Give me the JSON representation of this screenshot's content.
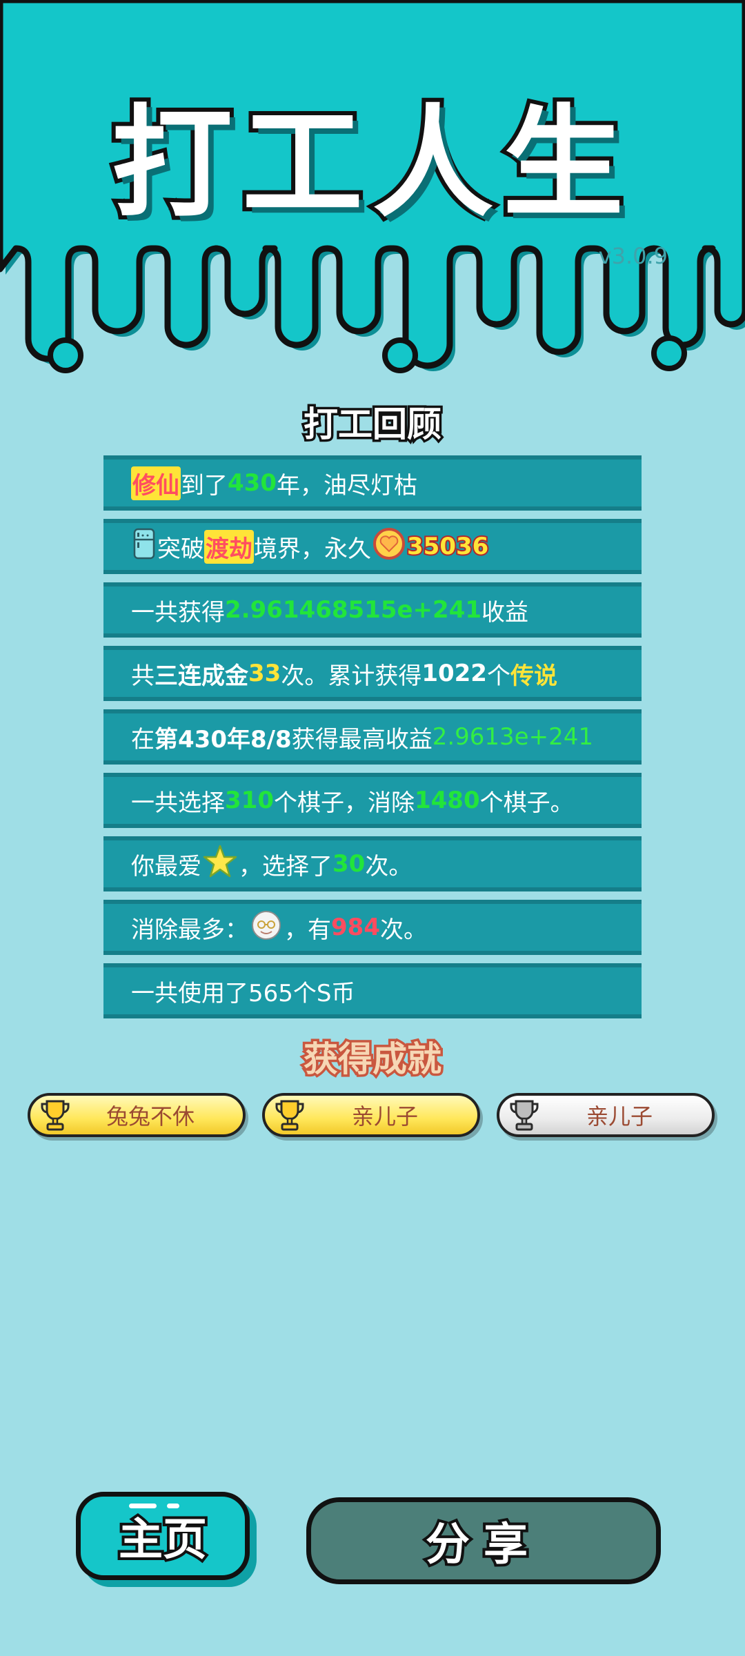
{
  "header": {
    "title": "打工人生",
    "version": "v3.0.9",
    "colors": {
      "teal": "#14c6c9",
      "outline": "#111111",
      "background": "#9fdee6"
    }
  },
  "review": {
    "title": "打工回顾",
    "rows": [
      {
        "parts": [
          {
            "text": "修仙",
            "style": "hl-red"
          },
          {
            "text": "到了"
          },
          {
            "text": "430",
            "style": "g"
          },
          {
            "text": "年，油尽灯枯"
          }
        ]
      },
      {
        "parts": [
          {
            "icon": "fridge-icon"
          },
          {
            "text": "突破"
          },
          {
            "text": "渡劫",
            "style": "hl-red"
          },
          {
            "text": "境界，永久"
          },
          {
            "icon": "heart-coin-icon"
          },
          {
            "text": "35036",
            "style": "hl-gold"
          }
        ]
      },
      {
        "parts": [
          {
            "text": "一共获得"
          },
          {
            "text": "2.961468515e+241",
            "style": "g"
          },
          {
            "text": "收益"
          }
        ]
      },
      {
        "parts": [
          {
            "text": "共"
          },
          {
            "text": "三连成金",
            "style": "bold"
          },
          {
            "text": "33",
            "style": "y"
          },
          {
            "text": "次。累计获得"
          },
          {
            "text": "1022",
            "style": "bold"
          },
          {
            "text": "个"
          },
          {
            "text": "传说",
            "style": "y"
          }
        ]
      },
      {
        "parts": [
          {
            "text": "在 "
          },
          {
            "text": "第430年8/8",
            "style": "bold"
          },
          {
            "text": " 获得最高收益"
          },
          {
            "text": "2.9613e+241",
            "style": "g-light"
          }
        ]
      },
      {
        "parts": [
          {
            "text": "一共选择"
          },
          {
            "text": "310",
            "style": "g"
          },
          {
            "text": "个棋子，消除"
          },
          {
            "text": "1480",
            "style": "g"
          },
          {
            "text": "个棋子。"
          }
        ]
      },
      {
        "parts": [
          {
            "text": "你最爱"
          },
          {
            "icon": "star-icon"
          },
          {
            "text": "，选择了"
          },
          {
            "text": "30",
            "style": "g"
          },
          {
            "text": "次。"
          }
        ]
      },
      {
        "parts": [
          {
            "text": "消除最多："
          },
          {
            "icon": "old-man-face-icon"
          },
          {
            "text": "，有"
          },
          {
            "text": "984",
            "style": "r"
          },
          {
            "text": "次。"
          }
        ]
      },
      {
        "parts": [
          {
            "text": "一共使用了565个S币"
          }
        ]
      }
    ]
  },
  "achievements": {
    "title": "获得成就",
    "items": [
      {
        "label": "兔兔不休",
        "tier": "gold"
      },
      {
        "label": "亲儿子",
        "tier": "gold"
      },
      {
        "label": "亲儿子",
        "tier": "silver"
      }
    ]
  },
  "buttons": {
    "home": "主页",
    "share": "分享"
  }
}
